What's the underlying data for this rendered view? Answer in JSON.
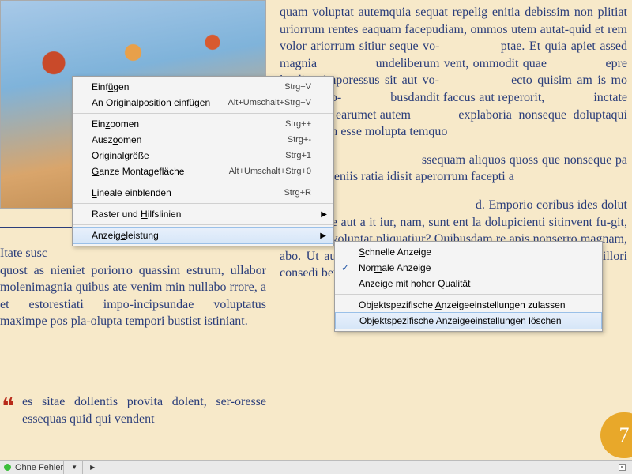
{
  "document": {
    "text_right": "quam voluptat autemquia sequat repelig enitia debissim non plitiat uriorrum rentes eaquam facepudiam, ommos utem autat-quid et rem volor ariorrum sitiur seque vo-              ptae. Et quia apiet assed magnia              undeliberum vent, ommodit quae              epre landign imporessus sit aut vo-              ecto quisim am is mo beaquos do-              busdandit faccus aut reperorit,              inctate nonserchil earumet autem              explaboria  nonseque  doluptaqui              n nulparum esse molupta temquo",
    "text_right_p2a": "                                      ssequam aliquos quoss que nonseque pa dolupit veleniis ratia idisit aperorrum facepti a",
    "text_right_p2b": "Obis dol                                          d. Emporio coribus ides dolut apicate que aut a it iur, nam, sunt ent la dolupicienti sitinvent fu-git, sum cone voluptat pliquatiur? Quibusdam re apis nonserro magnam, abo. Ut aut et dolo-reribus evendae rspicil litatur esenis anihillori consedi berrum sinvenimusam imus dolen-",
    "text_left_lower": "Itate susc\nquost as nieniet poriorro quassim estrum, ullabor molenimagnia quibus ate venim min nullabo rrore, a et estorestiati impo-incipsundae voluptatus maximpe pos pla-olupta tempori bustist istiniant.",
    "text_left_quote": "es sitae dollentis provita dolent, ser-oresse essequas quid qui vendent",
    "page_number": "7"
  },
  "context_menu": {
    "groups": [
      [
        {
          "label_pre": "Einf",
          "u": "ü",
          "label_post": "gen",
          "shortcut": "Strg+V"
        },
        {
          "label_pre": "An ",
          "u": "O",
          "label_post": "riginalposition einfügen",
          "shortcut": "Alt+Umschalt+Strg+V"
        }
      ],
      [
        {
          "label_pre": "Ein",
          "u": "z",
          "label_post": "oomen",
          "shortcut": "Strg++"
        },
        {
          "label_pre": "Ausz",
          "u": "o",
          "label_post": "omen",
          "shortcut": "Strg+-"
        },
        {
          "label_pre": "Originalgr",
          "u": "ö",
          "label_post": "ße",
          "shortcut": "Strg+1"
        },
        {
          "label_pre": "",
          "u": "G",
          "label_post": "anze Montagefläche",
          "shortcut": "Alt+Umschalt+Strg+0"
        }
      ],
      [
        {
          "label_pre": "",
          "u": "L",
          "label_post": "ineale einblenden",
          "shortcut": "Strg+R"
        }
      ],
      [
        {
          "label_pre": "Raster und ",
          "u": "H",
          "label_post": "ilfslinien",
          "shortcut": "",
          "arrow": true
        }
      ],
      [
        {
          "label_pre": "Anzeig",
          "u": "e",
          "label_post": "leistung",
          "shortcut": "",
          "arrow": true,
          "hi": true
        }
      ]
    ]
  },
  "submenu": {
    "groups": [
      [
        {
          "label_pre": "",
          "u": "S",
          "label_post": "chnelle Anzeige"
        },
        {
          "label_pre": "Nor",
          "u": "m",
          "label_post": "ale Anzeige",
          "checked": true
        },
        {
          "label_pre": "Anzeige mit hoher ",
          "u": "Q",
          "label_post": "ualität"
        }
      ],
      [
        {
          "label_pre": "Objektspezifische ",
          "u": "A",
          "label_post": "nzeigeeinstellungen zulassen"
        },
        {
          "label_pre": "",
          "u": "O",
          "label_post": "bjektspezifische Anzeigeeinstellungen löschen",
          "hi": true
        }
      ]
    ]
  },
  "status": {
    "label": "Ohne Fehler"
  }
}
